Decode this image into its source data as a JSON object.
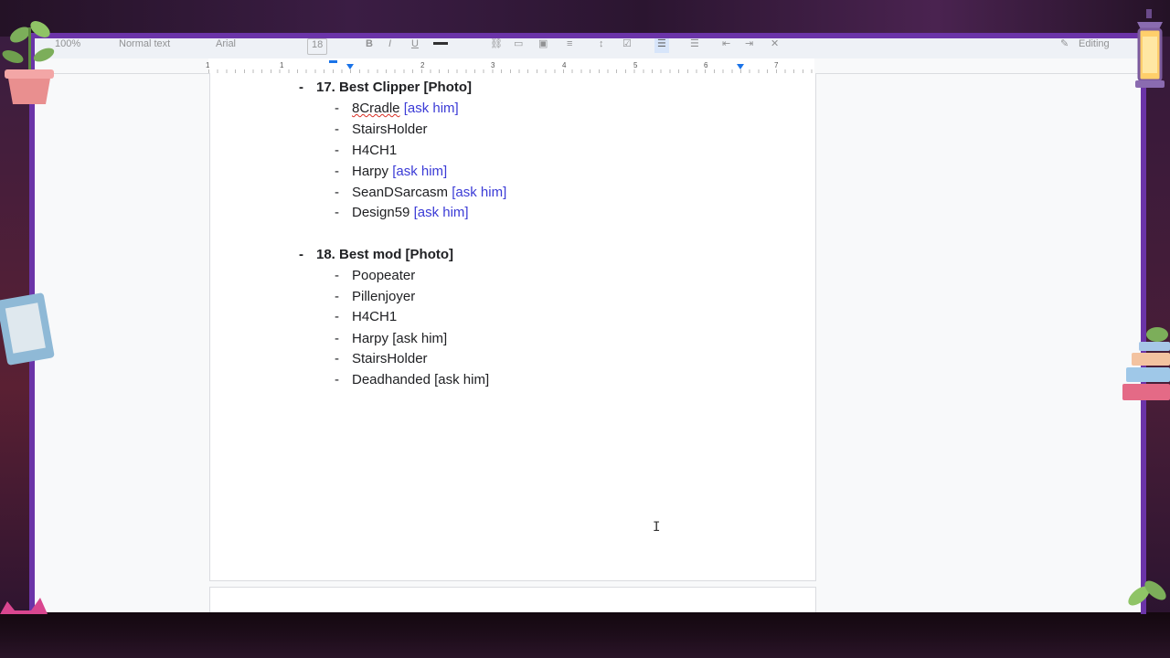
{
  "toolbar": {
    "zoom": "100%",
    "style": "Normal text",
    "font": "Arial",
    "font_size": "18",
    "mode": "Editing"
  },
  "ruler": {
    "numbers": [
      "1",
      "1",
      "2",
      "3",
      "4",
      "5",
      "6",
      "7"
    ]
  },
  "document": {
    "sections": [
      {
        "heading": "17. Best Clipper [Photo]",
        "items": [
          {
            "name": "8Cradle",
            "note": "[ask him]",
            "note_style": "link",
            "misspelled": true
          },
          {
            "name": "StairsHolder",
            "note": ""
          },
          {
            "name": "H4CH1",
            "note": ""
          },
          {
            "name": "Harpy",
            "note": "[ask him]",
            "note_style": "link"
          },
          {
            "name": "SeanDSarcasm",
            "note": "[ask him]",
            "note_style": "link"
          },
          {
            "name": "Design59",
            "note": "[ask him]",
            "note_style": "link"
          }
        ]
      },
      {
        "heading": "18. Best mod [Photo]",
        "items": [
          {
            "name": "Poopeater",
            "note": ""
          },
          {
            "name": "Pillenjoyer",
            "note": ""
          },
          {
            "name": "H4CH1",
            "note": ""
          },
          {
            "name": "Harpy",
            "note": "[ask him]",
            "note_style": "plain"
          },
          {
            "name": "StairsHolder",
            "note": ""
          },
          {
            "name": "Deadhanded",
            "note": "[ask him]",
            "note_style": "plain"
          }
        ]
      }
    ],
    "bullet": "-"
  },
  "colors": {
    "frame": "#6b34a8",
    "link_text": "#3b3bd6",
    "ruler_marker": "#1a73e8"
  }
}
